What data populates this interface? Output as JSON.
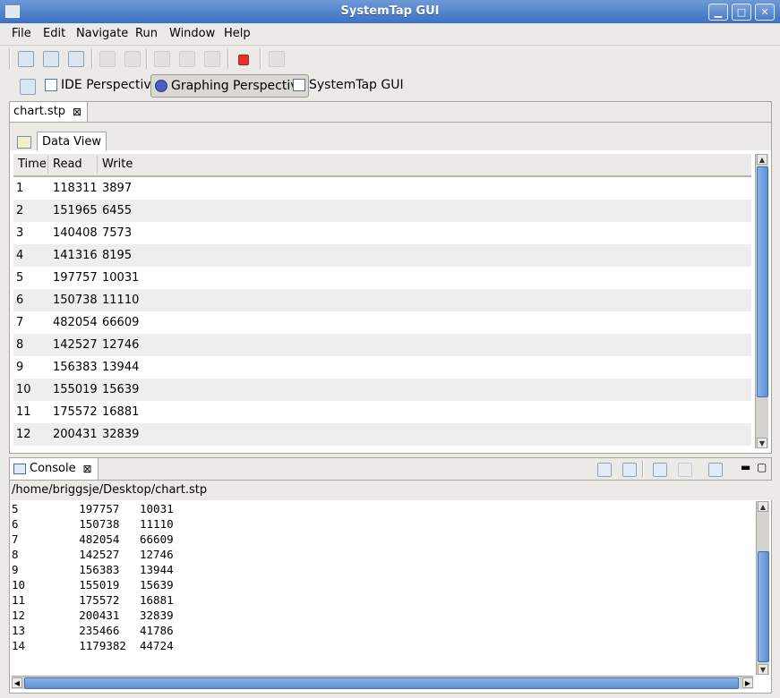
{
  "window": {
    "title": "SystemTap GUI"
  },
  "menubar": {
    "items": [
      "File",
      "Edit",
      "Navigate",
      "Run",
      "Window",
      "Help"
    ]
  },
  "perspectives": {
    "items": [
      "IDE Perspective",
      "Graphing Perspective",
      "SystemTap GUI"
    ],
    "active": "Graphing Perspective"
  },
  "editor": {
    "tab_label": "chart.stp",
    "subtab_label": "Data View"
  },
  "table": {
    "columns": [
      "Time",
      "Read",
      "Write"
    ],
    "rows": [
      [
        "1",
        "118311",
        "3897"
      ],
      [
        "2",
        "151965",
        "6455"
      ],
      [
        "3",
        "140408",
        "7573"
      ],
      [
        "4",
        "141316",
        "8195"
      ],
      [
        "5",
        "197757",
        "10031"
      ],
      [
        "6",
        "150738",
        "11110"
      ],
      [
        "7",
        "482054",
        "66609"
      ],
      [
        "8",
        "142527",
        "12746"
      ],
      [
        "9",
        "156383",
        "13944"
      ],
      [
        "10",
        "155019",
        "15639"
      ],
      [
        "11",
        "175572",
        "16881"
      ],
      [
        "12",
        "200431",
        "32839"
      ]
    ]
  },
  "console": {
    "tab_label": "Console",
    "path": "/home/briggsje/Desktop/chart.stp",
    "lines": [
      "5         197757   10031",
      "6         150738   11110",
      "7         482054   66609",
      "8         142527   12746",
      "9         156383   13944",
      "10        155019   15639",
      "11        175572   16881",
      "12        200431   32839",
      "13        235466   41786",
      "14        1179382  44724"
    ]
  },
  "icons": {
    "toolbar": [
      "save-icon",
      "import-icon",
      "export-icon",
      "save-disabled-icon",
      "print-icon",
      "cut-icon",
      "copy-icon",
      "paste-icon",
      "stop-icon",
      "undo-icon"
    ],
    "console": [
      "clear-console-icon",
      "scroll-lock-icon",
      "pin-console-icon",
      "display-console-icon",
      "open-console-icon",
      "minimize-icon",
      "maximize-icon"
    ]
  },
  "colors": {
    "titlebar": "#4a7cc6",
    "stop": "#e0332f",
    "scrollbar_thumb": "#5c8fd6",
    "row_alt": "#eeeeee"
  }
}
